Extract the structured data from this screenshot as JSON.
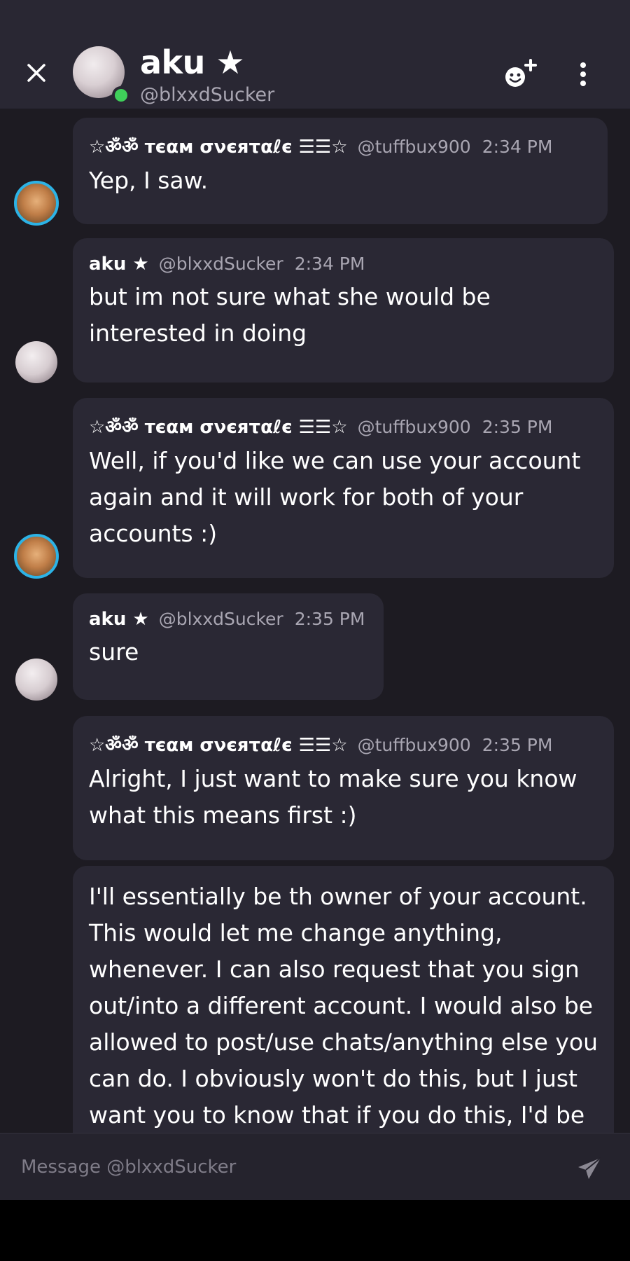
{
  "header": {
    "name": "aku ★",
    "handle": "@blxxdSucker",
    "status_color": "#3fcf5a"
  },
  "icons": {
    "close": "close-icon",
    "add_friend": "add-friend-icon",
    "more": "more-vertical-icon",
    "send": "send-icon"
  },
  "messages": [
    {
      "author": "☆ॐॐ тєαм σνєяταℓє ☰☰☆",
      "handle": "@tuffbux900",
      "time": "2:34 PM",
      "text": "Yep, I saw."
    },
    {
      "author": "aku ★",
      "handle": "@blxxdSucker",
      "time": "2:34 PM",
      "text": "but im not sure what she would be\ninterested in doing"
    },
    {
      "author": "☆ॐॐ тєαм σνєяταℓє ☰☰☆",
      "handle": "@tuffbux900",
      "time": "2:35 PM",
      "text": "Well, if you'd like we can use your account\nagain and it will work for both of your\naccounts :)"
    },
    {
      "author": "aku ★",
      "handle": "@blxxdSucker",
      "time": "2:35 PM",
      "text": "sure"
    },
    {
      "author": "☆ॐॐ тєαм σνєяταℓє ☰☰☆",
      "handle": "@tuffbux900",
      "time": "2:35 PM",
      "text": "Alright, I just want to make sure you know\nwhat this means first :)"
    },
    {
      "text": "I'll essentially be th owner of your account.\nThis would let me change anything,\nwhenever. I can also request that you sign\nout/into a different account. I would also be\nallowed to post/use chats/anything else you\ncan do. I obviously won't do this, but I just\nwant you to know that if you do this, I'd be"
    }
  ],
  "composer": {
    "placeholder": "Message @blxxdSucker"
  }
}
